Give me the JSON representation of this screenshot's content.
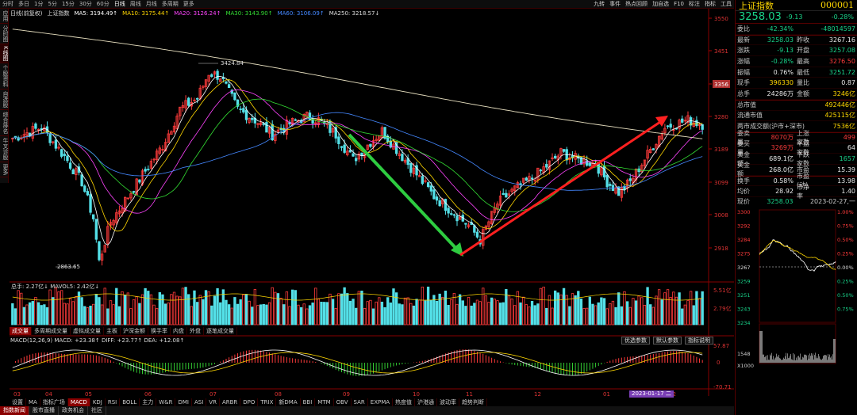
{
  "topbar": {
    "items": [
      "分时",
      "多日",
      "1分",
      "5分",
      "15分",
      "30分",
      "60分",
      "日线",
      "周线",
      "月线",
      "多周期",
      "更多"
    ],
    "active_index": 7,
    "right_items": [
      "九转",
      "事件",
      "热点回顾",
      "加自选",
      "F10",
      "标注",
      "指标",
      "工具"
    ]
  },
  "left_tabs": [
    "应用",
    "分时图",
    "K线图",
    "个股资料",
    "自选股",
    "综合排名",
    "牛叉诊股",
    "更多"
  ],
  "left_tabs_active": 2,
  "info_line": {
    "period": "日线(前复权)",
    "name": "上证指数",
    "ma": [
      {
        "label": "MA5: 3194.49↑",
        "color": "#ffffff"
      },
      {
        "label": "MA10: 3175.44↑",
        "color": "#ffd700"
      },
      {
        "label": "MA20: 3126.24↑",
        "color": "#ff44ff"
      },
      {
        "label": "MA30: 3143.90↑",
        "color": "#33dd33"
      },
      {
        "label": "MA60: 3106.09↑",
        "color": "#4488ff"
      },
      {
        "label": "MA250: 3218.57↓",
        "color": "#dddddd"
      }
    ]
  },
  "price_axis": [
    "3550",
    "3451",
    "3356",
    "3280",
    "3189",
    "3099",
    "3008",
    "2918"
  ],
  "price_axis_highlight": "3356",
  "high_label": "3424.84",
  "low_label": "2863.65",
  "volume": {
    "info": "总手: 2.27亿↓  MAVOL5: 2.42亿↓",
    "axis": [
      "5.51亿",
      "2.79亿"
    ]
  },
  "indicator_tabs": [
    "成交量",
    "多周期成交量",
    "虚拟成交量",
    "主板",
    "沪深金额",
    "换手率",
    "内盘",
    "外盘",
    "逐笔成交量"
  ],
  "macd": {
    "info": "MACD(12,26,9)  MACD: +23.38↑  DIFF: +23.77↑  DEA: +12.08↑",
    "buttons": [
      "优选参数",
      "默认参数",
      "指标说明"
    ],
    "axis": [
      "57.87",
      "0",
      "-70.71"
    ]
  },
  "month_labels": [
    "03",
    "04",
    "05",
    "06",
    "07",
    "08",
    "09",
    "10",
    "11",
    "12",
    "01",
    "02"
  ],
  "date_badge": "2023-01-17 二",
  "macd_tabs": [
    "设置",
    "MA",
    "指标广场",
    "MACD",
    "KDJ",
    "RSI",
    "BOLL",
    "主力",
    "W&R",
    "DMI",
    "ASI",
    "VR",
    "ARBR",
    "DPO",
    "TRIX",
    "新DMA",
    "BBI",
    "MTM",
    "OBV",
    "SAR",
    "EXPMA",
    "热度值",
    "沪港通",
    "波动率",
    "趋势判断"
  ],
  "macd_tabs_active": 3,
  "bottom_bar": [
    "指数新闻",
    "股市直播",
    "政务机会",
    "社区"
  ],
  "bottom_active": 0,
  "right_panel": {
    "name": "上证指数",
    "code": "000001",
    "price": "3258.03",
    "change": "-9.13",
    "change_pct": "-0.28%",
    "rows": [
      {
        "c1": "委比",
        "v1": "-42.34%",
        "v1c": "grn",
        "c2": "",
        "v2": "-48014597",
        "v2c": "grn"
      },
      {
        "c1": "最新",
        "v1": "3258.03",
        "v1c": "grn",
        "c2": "昨收",
        "v2": "3267.16",
        "v2c": "wht"
      },
      {
        "c1": "涨跌",
        "v1": "-9.13",
        "v1c": "grn",
        "c2": "开盘",
        "v2": "3257.08",
        "v2c": "grn"
      },
      {
        "c1": "涨幅",
        "v1": "-0.28%",
        "v1c": "grn",
        "c2": "最高",
        "v2": "3276.50",
        "v2c": "red"
      },
      {
        "c1": "振幅",
        "v1": "0.76%",
        "v1c": "wht",
        "c2": "最低",
        "v2": "3251.72",
        "v2c": "grn"
      },
      {
        "c1": "现手",
        "v1": "396330",
        "v1c": "yel",
        "c2": "量比",
        "v2": "0.87",
        "v2c": "wht"
      },
      {
        "c1": "总手",
        "v1": "24286万",
        "v1c": "wht",
        "c2": "金额",
        "v2": "3246亿",
        "v2c": "yel"
      },
      {
        "c1": "总市值",
        "v1": "",
        "v1c": "wht",
        "c2": "",
        "v2": "492446亿",
        "v2c": "yel"
      },
      {
        "c1": "流通市值",
        "v1": "",
        "v1c": "wht",
        "c2": "",
        "v2": "425115亿",
        "v2c": "yel"
      },
      {
        "c1": "两市成交额(沪市+深市)",
        "v1": "",
        "v1c": "wht",
        "c2": "",
        "v2": "7536亿",
        "v2c": "yel"
      },
      {
        "c1": "委卖量",
        "v1": "8070万",
        "v1c": "red",
        "c2": "上涨家数",
        "v2": "499",
        "v2c": "red"
      },
      {
        "c1": "委买量",
        "v1": "3269万",
        "v1c": "red",
        "c2": "平盘家数",
        "v2": "64",
        "v2c": "wht"
      },
      {
        "c1": "卖金额",
        "v1": "689.1亿",
        "v1c": "wht",
        "c2": "下跌家数",
        "v2": "1657",
        "v2c": "grn"
      },
      {
        "c1": "买金额",
        "v1": "268.0亿",
        "v1c": "wht",
        "c2": "市盈",
        "v2": "15.39",
        "v2c": "wht"
      },
      {
        "c1": "换手",
        "v1": "0.58%",
        "v1c": "wht",
        "c2": "市盈(动)",
        "v2": "13.98",
        "v2c": "wht"
      },
      {
        "c1": "均价",
        "v1": "28.92",
        "v1c": "wht",
        "c2": "市净率",
        "v2": "1.40",
        "v2c": "wht"
      }
    ],
    "current_label": "现价",
    "current_price": "3258.03",
    "current_date": "2023-02-27,一",
    "mini_axis_left": [
      "3300",
      "3292",
      "3284",
      "3275",
      "3267",
      "3259",
      "3251",
      "3243",
      "3234"
    ],
    "mini_axis_right": [
      "1.00%",
      "0.75%",
      "0.50%",
      "0.25%",
      "0.00%",
      "0.25%",
      "0.50%",
      "0.75%"
    ],
    "mini_vol_axis": [
      "1548",
      "X1000"
    ]
  },
  "colors": {
    "up": "#ff3b3b",
    "down": "#19d48a",
    "arrow_up": "#ff2020",
    "arrow_down": "#2ecc40"
  }
}
